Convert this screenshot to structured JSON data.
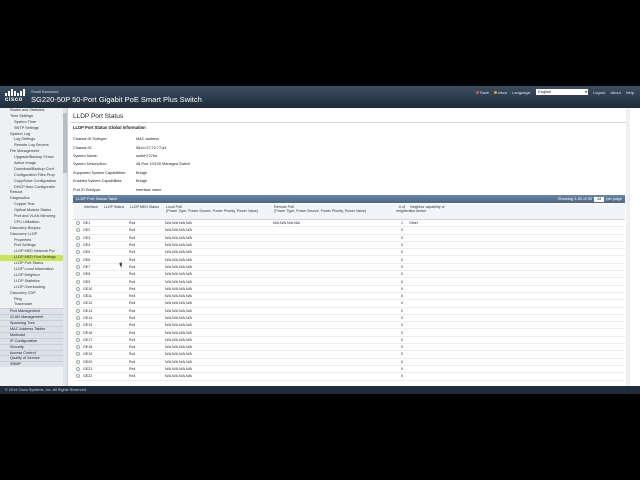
{
  "header": {
    "brand": "cisco",
    "brand_sub": "Small Business",
    "title": "SG220-50P 50-Port Gigabit PoE Smart Plus Switch",
    "nav": [
      {
        "label": "Save",
        "dot_color": "#d9534f"
      },
      {
        "label": "cisco",
        "dot_color": "#e5a32b"
      },
      {
        "label": "Language:"
      },
      {
        "label": "Logout"
      },
      {
        "label": "About"
      },
      {
        "label": "Help"
      }
    ],
    "language": "English"
  },
  "sidebar": {
    "items": [
      {
        "label": "Status and Statistics",
        "level": "l1"
      },
      {
        "label": "Time Settings",
        "level": "l1"
      },
      {
        "label": "System Time",
        "level": "l2"
      },
      {
        "label": "SNTP Settings",
        "level": "l2"
      },
      {
        "label": "System Log",
        "level": "l1"
      },
      {
        "label": "Log Settings",
        "level": "l2"
      },
      {
        "label": "Remote Log Servers",
        "level": "l2"
      },
      {
        "label": "File Management",
        "level": "l1"
      },
      {
        "label": "Upgrade/Backup Firmw",
        "level": "l2"
      },
      {
        "label": "Active Image",
        "level": "l2"
      },
      {
        "label": "Download/Backup Conf",
        "level": "l2"
      },
      {
        "label": "Configuration Files Prop",
        "level": "l2"
      },
      {
        "label": "Copy/Save Configuration",
        "level": "l2"
      },
      {
        "label": "DHCP Auto Configuratio",
        "level": "l2"
      },
      {
        "label": "Reboot",
        "level": "l1"
      },
      {
        "label": "Diagnostics",
        "level": "l1"
      },
      {
        "label": "Copper Test",
        "level": "l2"
      },
      {
        "label": "Optical Module Status",
        "level": "l2"
      },
      {
        "label": "Port and VLAN Mirroring",
        "level": "l2"
      },
      {
        "label": "CPU Utilization",
        "level": "l2"
      },
      {
        "label": "Discovery Bonjour",
        "level": "l1"
      },
      {
        "label": "Discovery LLDP",
        "level": "l1"
      },
      {
        "label": "Properties",
        "level": "l2"
      },
      {
        "label": "Port Settings",
        "level": "l2"
      },
      {
        "label": "LLDP MED Network Pol",
        "level": "l2"
      },
      {
        "label": "LLDP MED Port Settings",
        "level": "l2",
        "active": true
      },
      {
        "label": "LLDP Port Status",
        "level": "l2"
      },
      {
        "label": "LLDP Local Information",
        "level": "l2"
      },
      {
        "label": "LLDP Neighbor",
        "level": "l2"
      },
      {
        "label": "LLDP Statistics",
        "level": "l2"
      },
      {
        "label": "LLDP Overloading",
        "level": "l2"
      },
      {
        "label": "Discovery CDP",
        "level": "l1"
      },
      {
        "label": "Ping",
        "level": "l2"
      },
      {
        "label": "Traceroute",
        "level": "l2"
      },
      {
        "label": "Port Management",
        "level": "cat"
      },
      {
        "label": "VLAN Management",
        "level": "cat"
      },
      {
        "label": "Spanning Tree",
        "level": "cat"
      },
      {
        "label": "MAC Address Tables",
        "level": "cat"
      },
      {
        "label": "Multicast",
        "level": "cat"
      },
      {
        "label": "IP Configuration",
        "level": "cat"
      },
      {
        "label": "Security",
        "level": "cat"
      },
      {
        "label": "Access Control",
        "level": "cat"
      },
      {
        "label": "Quality of Service",
        "level": "cat"
      },
      {
        "label": "SNMP",
        "level": "cat"
      }
    ]
  },
  "main": {
    "page_title": "LLDP Port Status",
    "global_info_title": "LLDP Port Status Global Information",
    "global_info": [
      {
        "key": "Chassis ID Subtype:",
        "value": "MAC address"
      },
      {
        "key": "Chassis ID:",
        "value": "58:bc:27:72:77:a3"
      },
      {
        "key": "System Name:",
        "value": "switch727ba"
      },
      {
        "key": "System Description:",
        "value": "48-Port 10/100 Managed Switch"
      },
      {
        "key": "Supported System Capabilities:",
        "value": "Bridge"
      },
      {
        "key": "Enabled System Capabilities:",
        "value": "Bridge"
      },
      {
        "key": "Port ID Subtype:",
        "value": "Interface name"
      }
    ],
    "table_bar_title": "LLDP Port Status Table",
    "showing": "Showing 1-50 of 50",
    "per_page_value": "All",
    "per_page_label": "per page",
    "columns": {
      "interface": "Interface",
      "lldp_status": "LLDP Status",
      "lldp_med_status": "LLDP MED Status",
      "local_poe": "Local PoE",
      "local_poe_sub": "(Power Type, Power Source, Power Priority, Power Value)",
      "remote_poe": "Remote PoE",
      "remote_poe_sub": "(Power Type, Power Source, Power Priority, Power Value)",
      "num_neighbors": "# of neighbors",
      "neighbor_cap": "Neighbor capability of 1st device"
    },
    "rows": [
      {
        "if": "GE1",
        "status": "",
        "med": "Rx4",
        "local": "N/A,N/A,N/A,N/A",
        "remote": "N/A,N/A,N/A,N/A",
        "n": "1",
        "cap": "Other"
      },
      {
        "if": "GE2",
        "status": "",
        "med": "Rx4",
        "local": "N/A,N/A,N/A,N/A",
        "remote": "",
        "n": "0",
        "cap": ""
      },
      {
        "if": "GE3",
        "status": "",
        "med": "Rx4",
        "local": "N/A,N/A,N/A,N/A",
        "remote": "",
        "n": "0",
        "cap": ""
      },
      {
        "if": "GE4",
        "status": "",
        "med": "Rx4",
        "local": "N/A,N/A,N/A,N/A",
        "remote": "",
        "n": "0",
        "cap": ""
      },
      {
        "if": "GE5",
        "status": "",
        "med": "Rx4",
        "local": "N/A,N/A,N/A,N/A",
        "remote": "",
        "n": "0",
        "cap": ""
      },
      {
        "if": "GE6",
        "status": "",
        "med": "Rx4",
        "local": "N/A,N/A,N/A,N/A",
        "remote": "",
        "n": "0",
        "cap": ""
      },
      {
        "if": "GE7",
        "status": "",
        "med": "Rx4",
        "local": "N/A,N/A,N/A,N/A",
        "remote": "",
        "n": "0",
        "cap": ""
      },
      {
        "if": "GE8",
        "status": "",
        "med": "Rx4",
        "local": "N/A,N/A,N/A,N/A",
        "remote": "",
        "n": "0",
        "cap": ""
      },
      {
        "if": "GE9",
        "status": "",
        "med": "Rx4",
        "local": "N/A,N/A,N/A,N/A",
        "remote": "",
        "n": "0",
        "cap": ""
      },
      {
        "if": "GE10",
        "status": "",
        "med": "Rx4",
        "local": "N/A,N/A,N/A,N/A",
        "remote": "",
        "n": "0",
        "cap": ""
      },
      {
        "if": "GE11",
        "status": "",
        "med": "Rx4",
        "local": "N/A,N/A,N/A,N/A",
        "remote": "",
        "n": "0",
        "cap": ""
      },
      {
        "if": "GE12",
        "status": "",
        "med": "Rx4",
        "local": "N/A,N/A,N/A,N/A",
        "remote": "",
        "n": "0",
        "cap": ""
      },
      {
        "if": "GE13",
        "status": "",
        "med": "Rx4",
        "local": "N/A,N/A,N/A,N/A",
        "remote": "",
        "n": "0",
        "cap": ""
      },
      {
        "if": "GE14",
        "status": "",
        "med": "Rx4",
        "local": "N/A,N/A,N/A,N/A",
        "remote": "",
        "n": "0",
        "cap": ""
      },
      {
        "if": "GE15",
        "status": "",
        "med": "Rx4",
        "local": "N/A,N/A,N/A,N/A",
        "remote": "",
        "n": "0",
        "cap": ""
      },
      {
        "if": "GE16",
        "status": "",
        "med": "Rx4",
        "local": "N/A,N/A,N/A,N/A",
        "remote": "",
        "n": "0",
        "cap": ""
      },
      {
        "if": "GE17",
        "status": "",
        "med": "Rx4",
        "local": "N/A,N/A,N/A,N/A",
        "remote": "",
        "n": "0",
        "cap": ""
      },
      {
        "if": "GE18",
        "status": "",
        "med": "Rx4",
        "local": "N/A,N/A,N/A,N/A",
        "remote": "",
        "n": "0",
        "cap": ""
      },
      {
        "if": "GE19",
        "status": "",
        "med": "Rx4",
        "local": "N/A,N/A,N/A,N/A",
        "remote": "",
        "n": "0",
        "cap": ""
      },
      {
        "if": "GE20",
        "status": "",
        "med": "Rx4",
        "local": "N/A,N/A,N/A,N/A",
        "remote": "",
        "n": "0",
        "cap": ""
      },
      {
        "if": "GE21",
        "status": "",
        "med": "Rx4",
        "local": "N/A,N/A,N/A,N/A",
        "remote": "",
        "n": "0",
        "cap": ""
      },
      {
        "if": "GE22",
        "status": "",
        "med": "Rx4",
        "local": "N/A,N/A,N/A,N/A",
        "remote": "",
        "n": "0",
        "cap": ""
      }
    ]
  },
  "footer": {
    "copyright": "© 2014 Cisco Systems, Inc. All Rights Reserved."
  },
  "colors": {
    "header": "#1f2c3a",
    "table_bar": "#5b7596",
    "active_item": "#c9e45a"
  }
}
